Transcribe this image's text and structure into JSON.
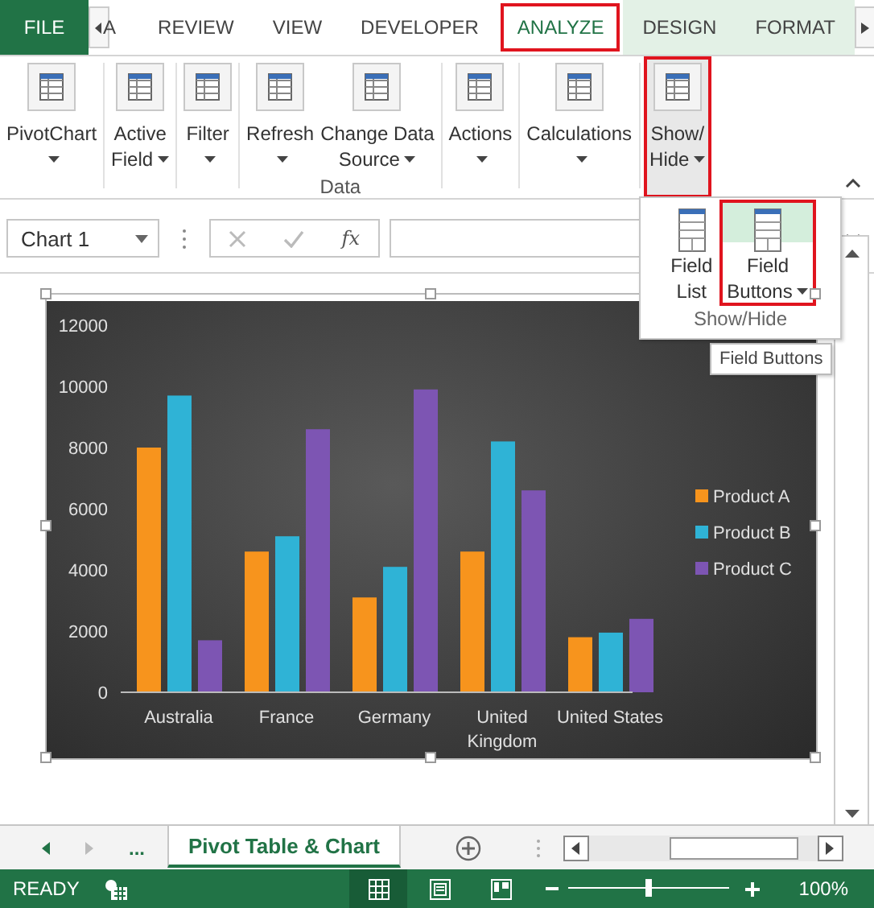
{
  "ribbon_tabs": [
    {
      "label": "FILE",
      "kind": "file",
      "selected": false,
      "highlighted": false,
      "contextual": false
    },
    {
      "label": "A",
      "kind": "tab",
      "selected": false,
      "highlighted": false,
      "contextual": false
    },
    {
      "label": "REVIEW",
      "kind": "tab",
      "selected": false,
      "highlighted": false,
      "contextual": false
    },
    {
      "label": "VIEW",
      "kind": "tab",
      "selected": false,
      "highlighted": false,
      "contextual": false
    },
    {
      "label": "DEVELOPER",
      "kind": "tab",
      "selected": false,
      "highlighted": false,
      "contextual": false
    },
    {
      "label": "ANALYZE",
      "kind": "tab",
      "selected": true,
      "highlighted": true,
      "contextual": true
    },
    {
      "label": "DESIGN",
      "kind": "tab",
      "selected": false,
      "highlighted": false,
      "contextual": true
    },
    {
      "label": "FORMAT",
      "kind": "tab",
      "selected": false,
      "highlighted": false,
      "contextual": true
    }
  ],
  "ribbon": {
    "groups": [
      {
        "buttons": [
          {
            "lines": [
              "PivotChart"
            ],
            "dropdown": true,
            "highlighted": false
          }
        ]
      },
      {
        "buttons": [
          {
            "lines": [
              "Active",
              "Field"
            ],
            "dropdown": true,
            "highlighted": false
          }
        ]
      },
      {
        "buttons": [
          {
            "lines": [
              "Filter"
            ],
            "dropdown": true,
            "highlighted": false
          }
        ]
      },
      {
        "label": "Data",
        "buttons": [
          {
            "lines": [
              "Refresh"
            ],
            "dropdown": true,
            "highlighted": false
          },
          {
            "lines": [
              "Change Data",
              "Source"
            ],
            "dropdown": true,
            "highlighted": false
          }
        ]
      },
      {
        "buttons": [
          {
            "lines": [
              "Actions"
            ],
            "dropdown": true,
            "highlighted": false
          }
        ]
      },
      {
        "buttons": [
          {
            "lines": [
              "Calculations"
            ],
            "dropdown": true,
            "highlighted": false
          }
        ]
      },
      {
        "buttons": [
          {
            "lines": [
              "Show/",
              "Hide"
            ],
            "dropdown": true,
            "highlighted": true
          }
        ]
      }
    ]
  },
  "show_hide_menu": {
    "buttons": [
      {
        "lines": [
          "Field",
          "List"
        ],
        "dropdown": false,
        "highlighted": false
      },
      {
        "lines": [
          "Field",
          "Buttons"
        ],
        "dropdown": true,
        "highlighted": true
      }
    ],
    "label": "Show/Hide",
    "tooltip": "Field Buttons"
  },
  "formula_bar": {
    "name_box": "Chart 1",
    "function_label": "fx"
  },
  "chart": {
    "chart_data": {
      "type": "bar",
      "categories": [
        "Australia",
        "France",
        "Germany",
        "United Kingdom",
        "United States"
      ],
      "series": [
        {
          "name": "Product A",
          "color": "#f7941d",
          "values": [
            8000,
            4600,
            3100,
            4600,
            1800
          ]
        },
        {
          "name": "Product B",
          "color": "#2fb3d6",
          "values": [
            9700,
            5100,
            4100,
            8200,
            1950
          ]
        },
        {
          "name": "Product C",
          "color": "#7d55b3",
          "values": [
            1700,
            8600,
            9900,
            6600,
            2400
          ]
        }
      ],
      "legend": true,
      "ylim": [
        0,
        12000
      ],
      "yticks": [
        0,
        2000,
        4000,
        6000,
        8000,
        10000,
        12000
      ]
    }
  },
  "sheet_tabs": {
    "more": "...",
    "tabs": [
      {
        "label": "Pivot Table & Chart",
        "selected": true
      }
    ]
  },
  "status_bar": {
    "status": "READY",
    "views": [
      {
        "selected": true
      },
      {
        "selected": false
      },
      {
        "selected": false
      }
    ],
    "zoom": {
      "level": 0.5,
      "reading": "100%"
    }
  }
}
